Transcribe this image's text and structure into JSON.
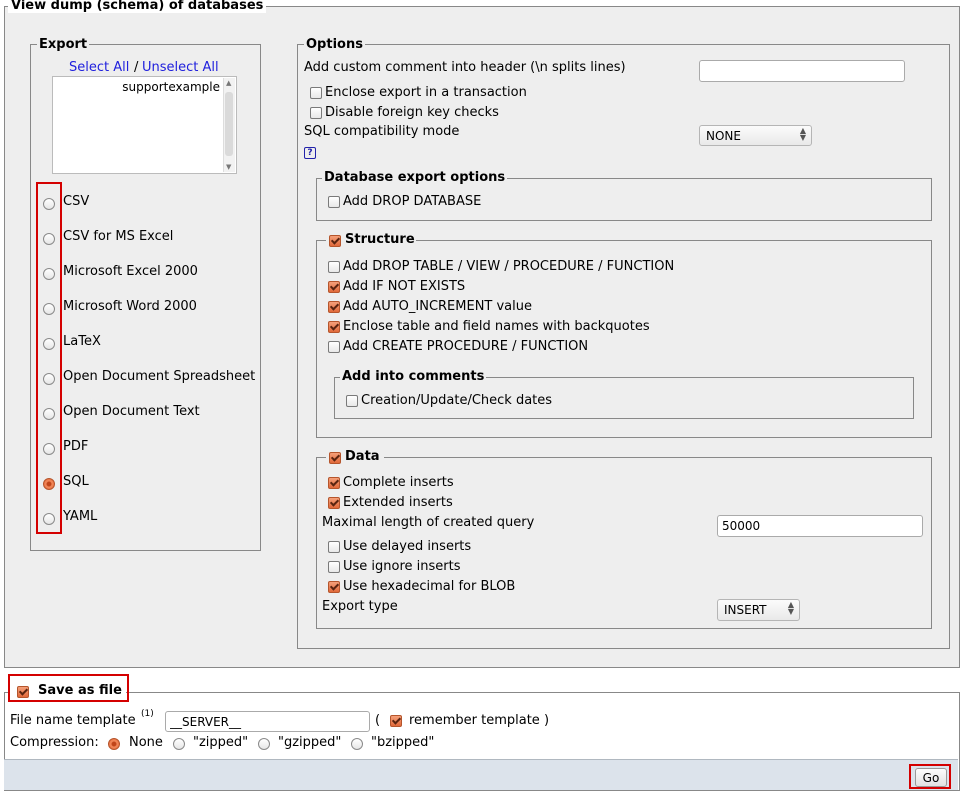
{
  "main_legend": "View dump (schema) of databases",
  "export": {
    "legend": "Export",
    "select_all": "Select All",
    "separator": "/",
    "unselect_all": "Unselect All",
    "databases": [
      "supportexample"
    ],
    "formats": [
      "CSV",
      "CSV for MS Excel",
      "Microsoft Excel 2000",
      "Microsoft Word 2000",
      "LaTeX",
      "Open Document Spreadsheet",
      "Open Document Text",
      "PDF",
      "SQL",
      "YAML"
    ],
    "selected_format": "SQL"
  },
  "options": {
    "legend": "Options",
    "custom_comment_label": "Add custom comment into header (\\n splits lines)",
    "custom_comment_value": "",
    "enclose_transaction": "Enclose export in a transaction",
    "disable_fk": "Disable foreign key checks",
    "sql_compat_label": "SQL compatibility mode",
    "sql_compat_value": "NONE",
    "help_icon": "?",
    "db_export": {
      "legend": "Database export options",
      "add_drop_database": "Add DROP DATABASE"
    },
    "structure": {
      "legend": "Structure",
      "checked": true,
      "items": [
        {
          "label": "Add DROP TABLE / VIEW / PROCEDURE / FUNCTION",
          "checked": false
        },
        {
          "label": "Add IF NOT EXISTS",
          "checked": true
        },
        {
          "label": "Add AUTO_INCREMENT value",
          "checked": true
        },
        {
          "label": "Enclose table and field names with backquotes",
          "checked": true
        },
        {
          "label": "Add CREATE PROCEDURE / FUNCTION",
          "checked": false
        }
      ],
      "comments": {
        "legend": "Add into comments",
        "dates": "Creation/Update/Check dates"
      }
    },
    "data": {
      "legend": "Data",
      "checked": true,
      "complete_inserts": "Complete inserts",
      "extended_inserts": "Extended inserts",
      "max_length_label": "Maximal length of created query",
      "max_length_value": "50000",
      "delayed_inserts": "Use delayed inserts",
      "ignore_inserts": "Use ignore inserts",
      "hex_blob": "Use hexadecimal for BLOB",
      "export_type_label": "Export type",
      "export_type_value": "INSERT"
    }
  },
  "save": {
    "legend": "Save as file",
    "filename_label": "File name template",
    "filename_sup": "(1)",
    "filename_value": "__SERVER__",
    "paren_open": "(",
    "remember_template": "remember template",
    "paren_close": ")",
    "compression_label": "Compression:",
    "compression_options": [
      "None",
      "\"zipped\"",
      "\"gzipped\"",
      "\"bzipped\""
    ]
  },
  "go_button": "Go",
  "colors": {
    "accent": "#e86b3b",
    "highlight": "#d40000",
    "panel": "#eeeeee",
    "footer": "#dce3eb"
  }
}
